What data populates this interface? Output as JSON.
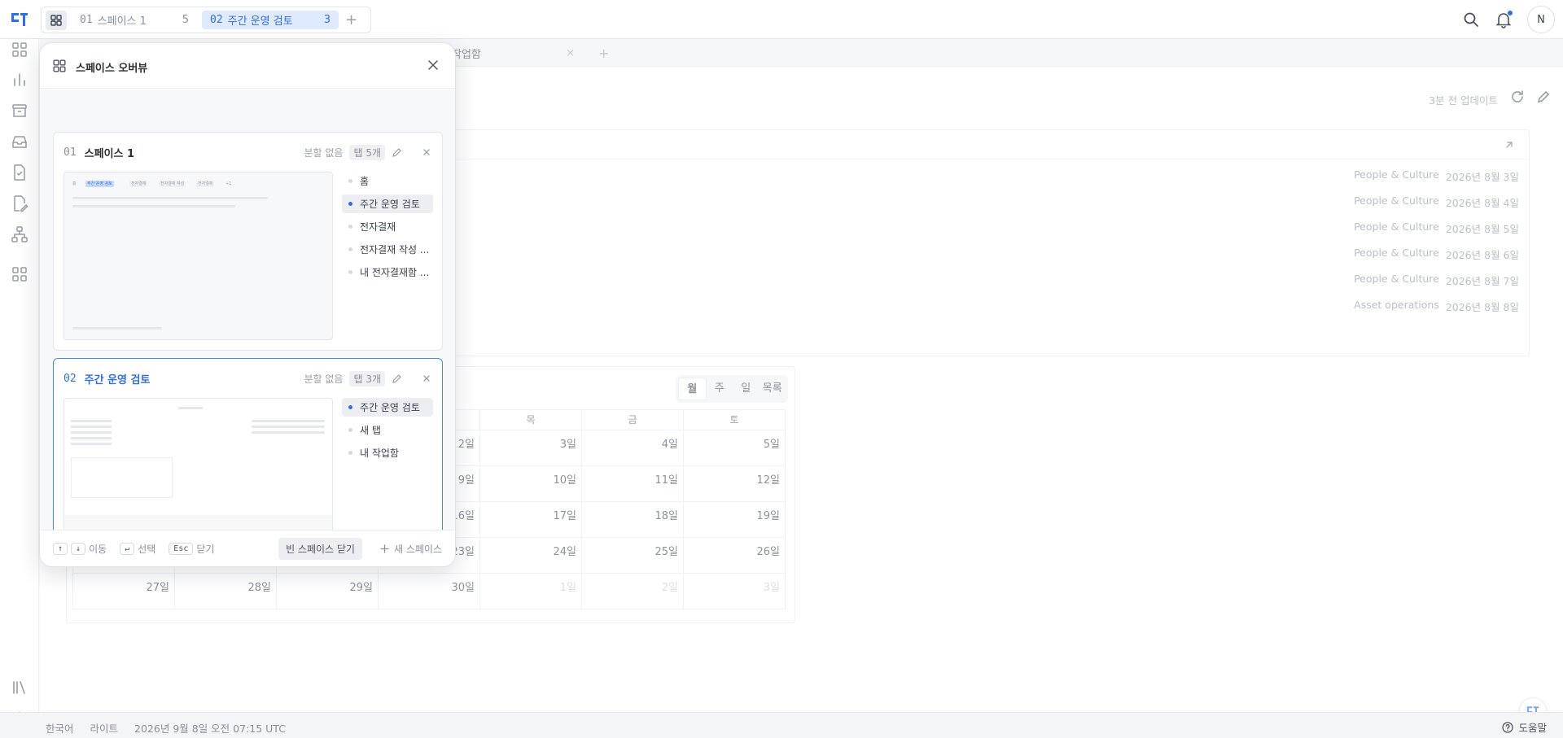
{
  "topbar": {
    "spaces": [
      {
        "code": "01",
        "name": "스페이스 1",
        "count": "5",
        "active": false
      },
      {
        "code": "02",
        "name": "주간 운영 검토",
        "count": "3",
        "active": true
      }
    ],
    "avatar_initial": "N"
  },
  "doc_tabs": [
    {
      "label": "작업함"
    }
  ],
  "content": {
    "updated": "3분 전 업데이트",
    "list_rows": [
      {
        "team": "People & Culture",
        "date": "2026년 8월 3일"
      },
      {
        "team": "People & Culture",
        "date": "2026년 8월 4일"
      },
      {
        "team": "People & Culture",
        "date": "2026년 8월 5일"
      },
      {
        "team": "People & Culture",
        "date": "2026년 8월 6일"
      },
      {
        "team": "People & Culture",
        "date": "2026년 8월 7일"
      },
      {
        "team": "Asset operations",
        "date": "2026년 8월 8일"
      }
    ],
    "calendar": {
      "views": [
        "월",
        "주",
        "일",
        "목록"
      ],
      "active_view": "월",
      "weekdays": [
        "",
        "",
        "",
        "",
        "목",
        "금",
        "토"
      ],
      "weeks": [
        [
          "",
          "",
          "",
          "2일",
          "3일",
          "4일",
          "5일"
        ],
        [
          "",
          "",
          "",
          "9일",
          "10일",
          "11일",
          "12일"
        ],
        [
          "",
          "",
          "",
          "16일",
          "17일",
          "18일",
          "19일"
        ],
        [
          "",
          "",
          "",
          "23일",
          "24일",
          "25일",
          "26일"
        ],
        [
          "27일",
          "28일",
          "29일",
          "30일",
          "1일",
          "2일",
          "3일"
        ]
      ],
      "muted_last_week_from": 4
    }
  },
  "statusbar": {
    "language": "한국어",
    "theme": "라이트",
    "datetime": "2026년 9월 8일 오전 07:15 UTC",
    "help": "도움말"
  },
  "overview": {
    "title": "스페이스 오버뷰",
    "spaces": [
      {
        "code": "01",
        "name": "스페이스 1",
        "split": "분할 없음",
        "tab_count": "탭 5개",
        "selected": false,
        "tabs": [
          {
            "label": "홈",
            "current": false
          },
          {
            "label": "주간 운영 검토",
            "current": true
          },
          {
            "label": "전자결재",
            "current": false
          },
          {
            "label": "전자결재 작성 ...",
            "current": false
          },
          {
            "label": "내 전자결재함 ...",
            "current": false
          }
        ],
        "thumb_chips": [
          "홈",
          "주간 운영 검토",
          "전자결재",
          "전자결재 작성",
          "전자결재",
          "+1"
        ]
      },
      {
        "code": "02",
        "name": "주간 운영 검토",
        "split": "분할 없음",
        "tab_count": "탭 3개",
        "selected": true,
        "tabs": [
          {
            "label": "주간 운영 검토",
            "current": true
          },
          {
            "label": "새 탭",
            "current": false
          },
          {
            "label": "내 작업함",
            "current": false
          }
        ]
      }
    ],
    "footer": {
      "move_keys": [
        "↑",
        "↓"
      ],
      "move_label": "이동",
      "select_key": "↵",
      "select_label": "선택",
      "close_key": "Esc",
      "close_label": "닫기",
      "close_empty": "빈 스페이스 닫기",
      "new_space": "새 스페이스"
    }
  },
  "colors": {
    "accent": "#2f6fde",
    "accent_light": "#dfeaff"
  }
}
